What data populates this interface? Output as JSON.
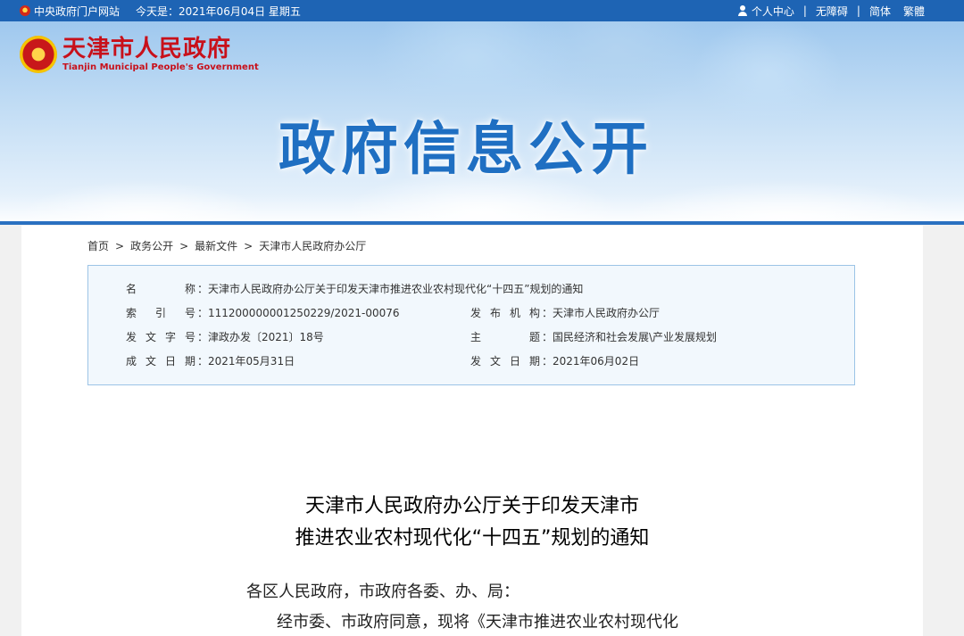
{
  "topbar": {
    "portal_link": "中央政府门户网站",
    "date_label": "今天是：2021年06月04日 星期五",
    "personal_center": "个人中心",
    "sep": "|",
    "accessibility": "无障碍",
    "simplified": "简体",
    "traditional": "繁體"
  },
  "header": {
    "site_name_cn": "天津市人民政府",
    "site_name_en": "Tianjin Municipal People's Government",
    "banner_title": "政府信息公开"
  },
  "breadcrumb": {
    "items": [
      "首页",
      "政务公开",
      "最新文件",
      "天津市人民政府办公厅"
    ],
    "separator": ">"
  },
  "meta": {
    "name_label": "名称",
    "name_value": "天津市人民政府办公厅关于印发天津市推进农业农村现代化“十四五”规划的通知",
    "index_label": "索引号",
    "index_value": "111200000001250229/2021-00076",
    "issuer_label": "发布机构",
    "issuer_value": "天津市人民政府办公厅",
    "docno_label": "发文字号",
    "docno_value": "津政办发〔2021〕18号",
    "topic_label": "主题",
    "topic_value": "国民经济和社会发展\\产业发展规划",
    "created_label": "成文日期",
    "created_value": "2021年05月31日",
    "published_label": "发文日期",
    "published_value": "2021年06月02日",
    "colon": "："
  },
  "document": {
    "title_line1": "天津市人民政府办公厅关于印发天津市",
    "title_line2": "推进农业农村现代化“十四五”规划的通知",
    "salutation": "各区人民政府，市政府各委、办、局：",
    "body_start": "经市委、市政府同意，现将《天津市推进农业农村现代化"
  }
}
